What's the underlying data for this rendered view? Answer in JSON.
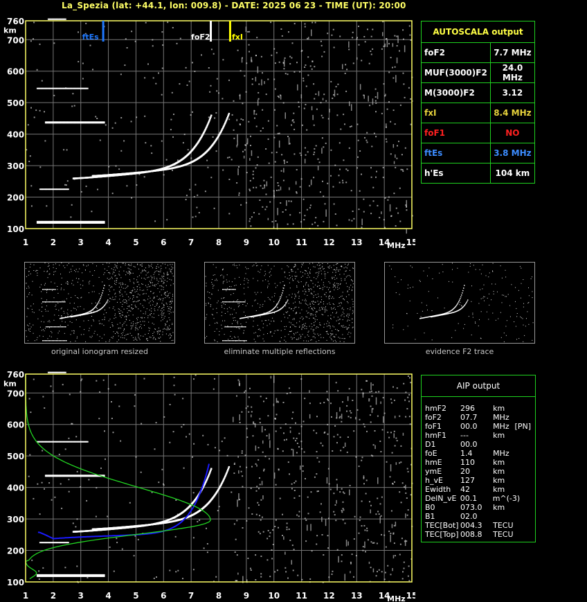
{
  "header": {
    "title": "La_Spezia (lat: +44.1, lon: 009.8) - DATE: 2025 06 23 - TIME (UT): 20:00"
  },
  "ionogram": {
    "y_unit": "km",
    "x_unit": "MHz",
    "y_ticks": [
      "760",
      "700",
      "600",
      "500",
      "400",
      "300",
      "200",
      "100"
    ],
    "x_ticks": [
      "1",
      "2",
      "3",
      "4",
      "5",
      "6",
      "7",
      "8",
      "9",
      "10",
      "11",
      "12",
      "13",
      "14",
      "15"
    ],
    "markers": {
      "ftEs": "ftEs",
      "foF2": "foF2",
      "fxI": "fxI"
    },
    "colors": {
      "grid": "#777777",
      "frame": "#ffff66",
      "ftEs": "#1e78ff",
      "fxI": "#ffff00",
      "foF2": "#ffffff",
      "aip_green": "#22d622",
      "aip_blue": "#1a1aff"
    }
  },
  "autoscala": {
    "title": "AUTOSCALA output",
    "rows": [
      {
        "label": "foF2",
        "value": "7.7 MHz",
        "color": "#ffffff"
      },
      {
        "label": "MUF(3000)F2",
        "value": "24.0 MHz",
        "color": "#ffffff"
      },
      {
        "label": "M(3000)F2",
        "value": "3.12",
        "color": "#ffffff"
      },
      {
        "label": "fxI",
        "value": "8.4 MHz",
        "color": "#e6d23c"
      },
      {
        "label": "foF1",
        "value": "NO",
        "color": "#ff2020"
      },
      {
        "label": "ftEs",
        "value": "3.8 MHz",
        "color": "#3c8cff"
      },
      {
        "label": "h'Es",
        "value": "104    km",
        "color": "#ffffff"
      }
    ]
  },
  "thumbnails": [
    {
      "caption": "original ionogram resized"
    },
    {
      "caption": "eliminate multiple reflections"
    },
    {
      "caption": "evidence F2 trace"
    }
  ],
  "aip": {
    "title": "AIP output",
    "rows": [
      [
        "hmF2",
        "296",
        "km",
        ""
      ],
      [
        "foF2",
        "07.7",
        "MHz",
        ""
      ],
      [
        "foF1",
        "00.0",
        "MHz",
        "[PN]"
      ],
      [
        "hmF1",
        "---",
        "km",
        ""
      ],
      [
        "D1",
        "00.0",
        "",
        ""
      ],
      [
        "foE",
        "1.4",
        "MHz",
        ""
      ],
      [
        "hmE",
        "110",
        "km",
        ""
      ],
      [
        "ymE",
        "20",
        "km",
        ""
      ],
      [
        "h_vE",
        "127",
        "km",
        ""
      ],
      [
        "Ewidth",
        "42",
        "km",
        ""
      ],
      [
        "DelN_vE",
        "00.1",
        "m^(-3)",
        ""
      ],
      [
        "B0",
        "073.0",
        "km",
        ""
      ],
      [
        "B1",
        "02.0",
        "",
        ""
      ],
      [
        "TEC[Bot]",
        "004.3",
        "TECU",
        ""
      ],
      [
        "TEC[Top]",
        "008.8",
        "TECU",
        ""
      ]
    ]
  }
}
